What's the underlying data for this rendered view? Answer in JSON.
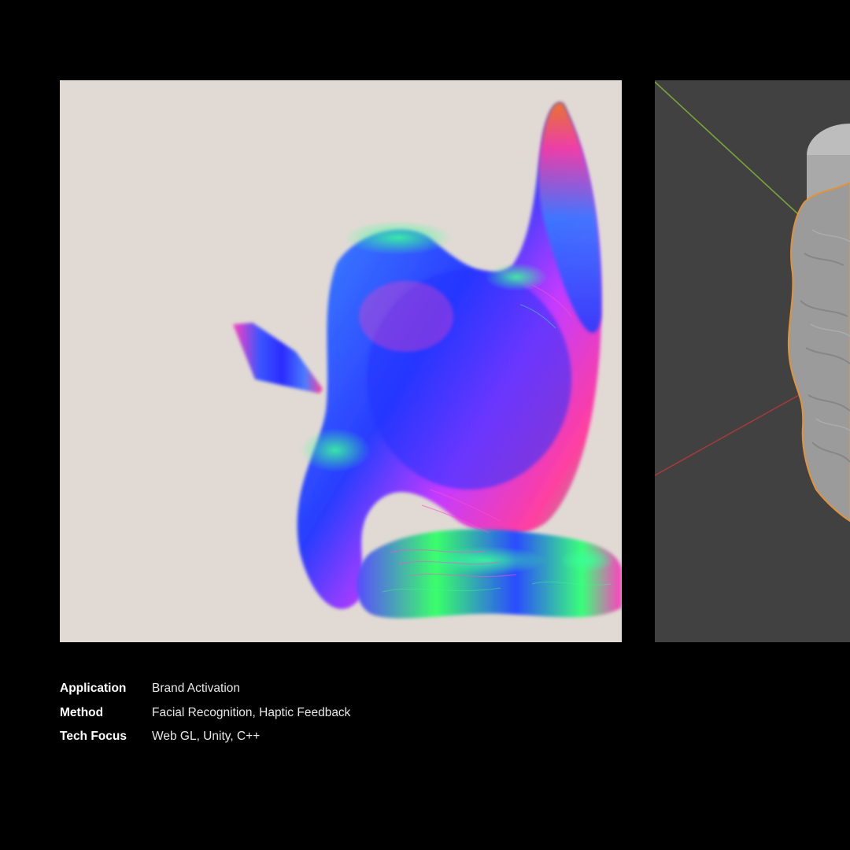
{
  "colors": {
    "background": "#000000",
    "left_panel_bg": "#e1dad4",
    "right_panel_bg": "#414141",
    "axis_green": "#7aa33a",
    "axis_red": "#a33a3a",
    "selection_outline": "#e3923a",
    "text": "#f2f2f2"
  },
  "media": {
    "left_render": {
      "icon": "normal-map-shader-render"
    },
    "right_render": {
      "icon": "3d-viewport-gray-mesh"
    }
  },
  "project_info": [
    {
      "label": "Application",
      "value": "Brand Activation"
    },
    {
      "label": "Method",
      "value": "Facial Recognition, Haptic Feedback"
    },
    {
      "label": "Tech Focus",
      "value": "Web GL, Unity, C++"
    }
  ]
}
